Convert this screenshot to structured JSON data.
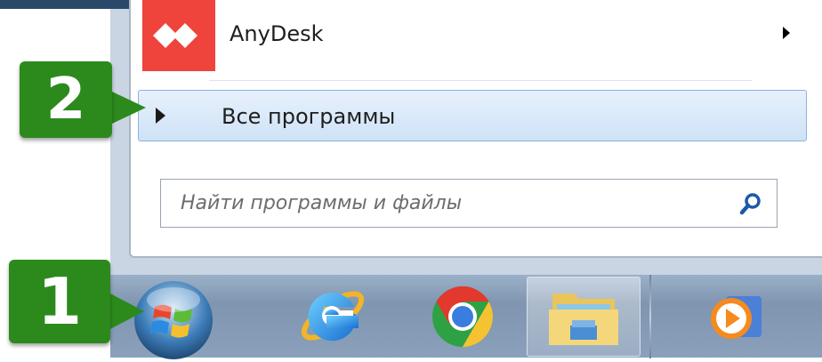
{
  "start_menu": {
    "pinned_item": {
      "label": "AnyDesk",
      "icon": "anydesk-icon",
      "color": "#ef443b"
    },
    "all_programs": {
      "label": "Все программы"
    },
    "search": {
      "placeholder": "Найти программы и файлы",
      "icon": "search-icon"
    }
  },
  "annotations": {
    "step1": "1",
    "step2": "2",
    "color": "#2c8a1c"
  },
  "taskbar": {
    "start_icon": "windows-start-orb-icon",
    "pinned": [
      {
        "icon": "internet-explorer-icon"
      },
      {
        "icon": "chrome-icon"
      },
      {
        "icon": "file-explorer-icon",
        "active": true
      },
      {
        "icon": "media-player-icon"
      }
    ]
  }
}
